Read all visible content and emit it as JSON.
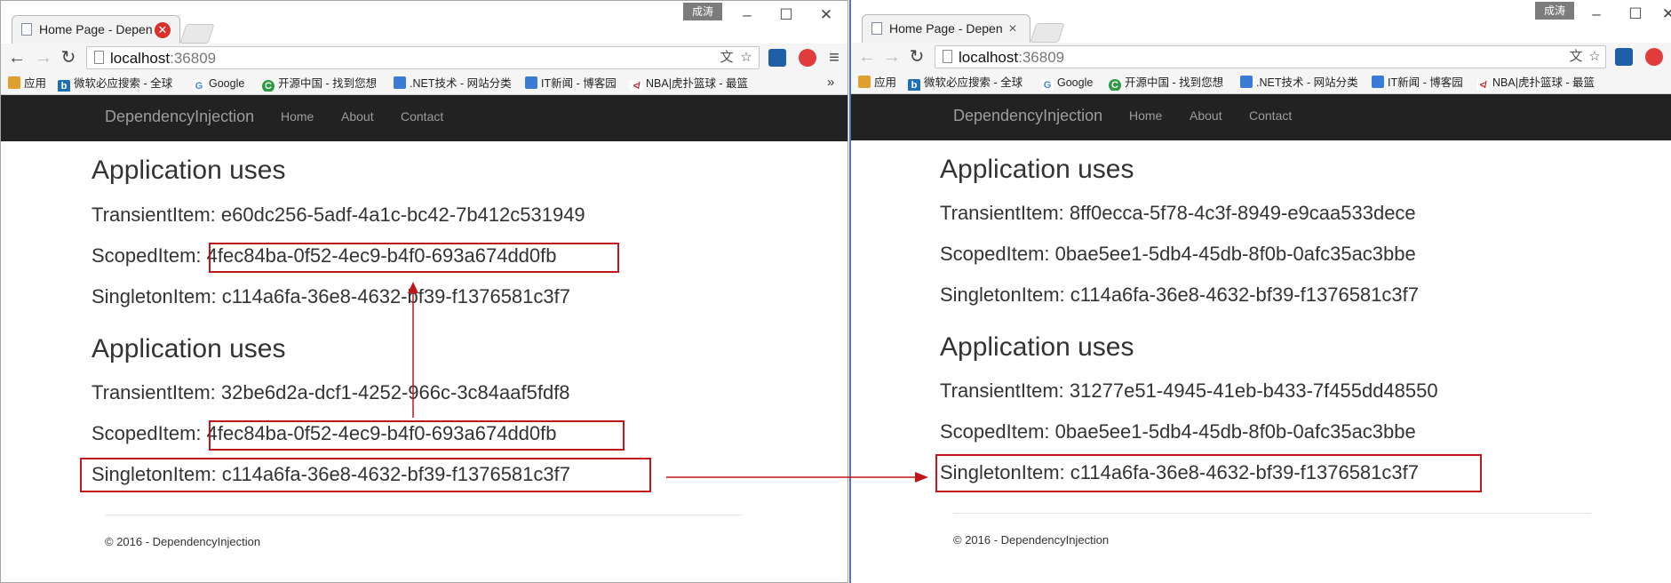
{
  "left": {
    "tab_title": "Home Page - Dependen",
    "user_badge": "成涛",
    "url_host": "localhost",
    "url_port": ":36809",
    "site": {
      "brand": "DependencyInjection",
      "nav": [
        "Home",
        "About",
        "Contact"
      ]
    },
    "sections": [
      {
        "heading": "Application uses",
        "transient": "TransientItem: e60dc256-5adf-4a1c-bc42-7b412c531949",
        "scoped": "ScopedItem: 4fec84ba-0f52-4ec9-b4f0-693a674dd0fb",
        "singleton": "SingletonItem: c114a6fa-36e8-4632-bf39-f1376581c3f7"
      },
      {
        "heading": "Application uses",
        "transient": "TransientItem: 32be6d2a-dcf1-4252-966c-3c84aaf5fdf8",
        "scoped": "ScopedItem: 4fec84ba-0f52-4ec9-b4f0-693a674dd0fb",
        "singleton": "SingletonItem: c114a6fa-36e8-4632-bf39-f1376581c3f7"
      }
    ],
    "footer": "© 2016 - DependencyInjection"
  },
  "right": {
    "tab_title": "Home Page - Depende",
    "user_badge": "成涛",
    "url_host": "localhost",
    "url_port": ":36809",
    "site": {
      "brand": "DependencyInjection",
      "nav": [
        "Home",
        "About",
        "Contact"
      ]
    },
    "sections": [
      {
        "heading": "Application uses",
        "transient": "TransientItem: 8ff0ecca-5f78-4c3f-8949-e9caa533dece",
        "scoped": "ScopedItem: 0bae5ee1-5db4-45db-8f0b-0afc35ac3bbe",
        "singleton": "SingletonItem: c114a6fa-36e8-4632-bf39-f1376581c3f7"
      },
      {
        "heading": "Application uses",
        "transient": "TransientItem: 31277e51-4945-41eb-b433-7f455dd48550",
        "scoped": "ScopedItem: 0bae5ee1-5db4-45db-8f0b-0afc35ac3bbe",
        "singleton": "SingletonItem: c114a6fa-36e8-4632-bf39-f1376581c3f7"
      }
    ],
    "footer": "© 2016 - DependencyInjection"
  },
  "bookmarks_left": [
    {
      "label": "应用"
    },
    {
      "label": "微软必应搜索 - 全球"
    },
    {
      "label": "Google"
    },
    {
      "label": "开源中国 - 找到您想"
    },
    {
      "label": ".NET技术 - 网站分类"
    },
    {
      "label": "IT新闻 - 博客园"
    },
    {
      "label": "NBA|虎扑篮球 - 最篮"
    }
  ],
  "bookmarks_right": [
    {
      "label": "应用"
    },
    {
      "label": "微软必应搜索 - 全球"
    },
    {
      "label": "Google"
    },
    {
      "label": "开源中国 - 找到您想"
    },
    {
      "label": ".NET技术 - 网站分类"
    },
    {
      "label": "IT新闻 - 博客园"
    },
    {
      "label": "NBA|虎扑篮球 - 最篮"
    }
  ],
  "icons": {
    "back": "arrow-left-icon",
    "forward": "arrow-right-icon",
    "reload": "reload-icon",
    "translate": "translate-icon",
    "star": "star-icon",
    "menu": "menu-icon"
  },
  "colors": {
    "annotation": "#c0161c",
    "navbar": "#222222",
    "close_tab": "#d9302c"
  }
}
